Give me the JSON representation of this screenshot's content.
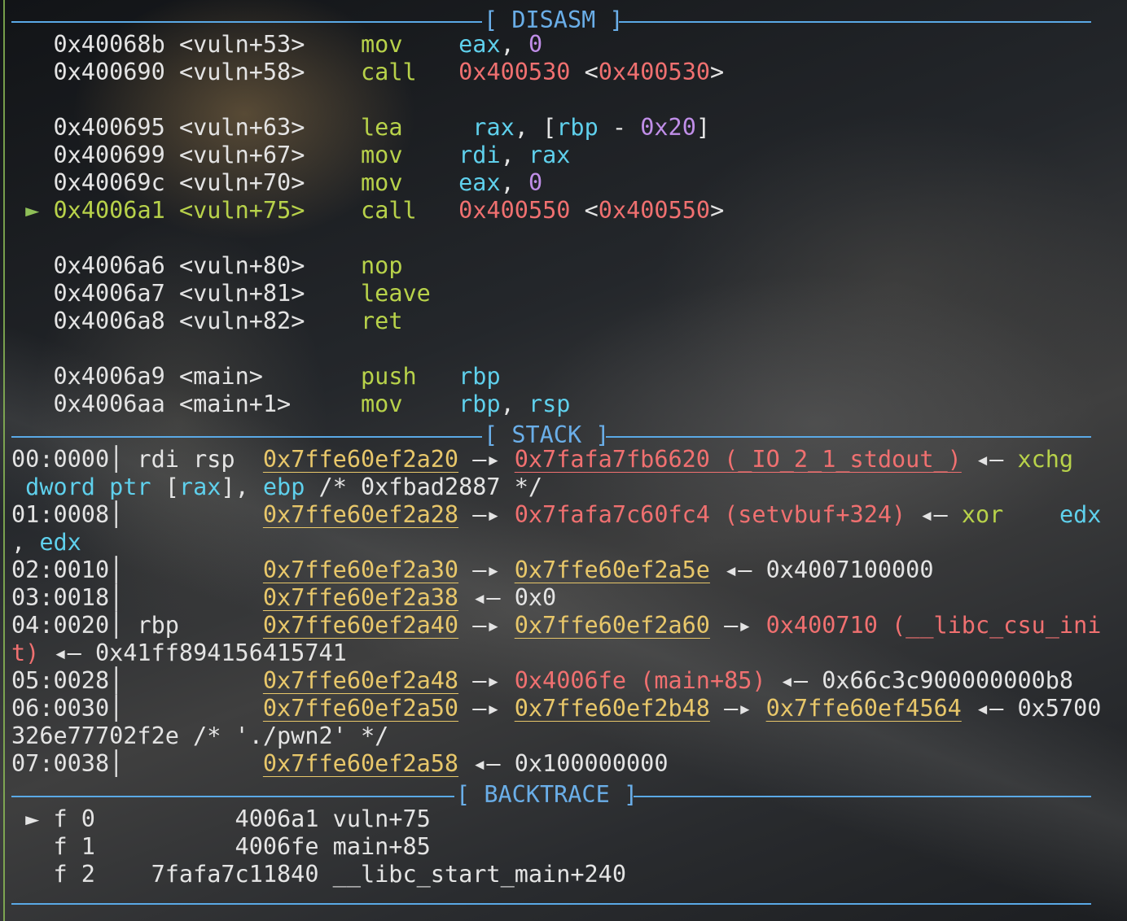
{
  "sections": {
    "disasm": "[ DISASM ]",
    "stack": "[ STACK ]",
    "backtrace": "[ BACKTRACE ]"
  },
  "disasm": [
    {
      "addr": "0x40068b",
      "sym": "<vuln+53>",
      "mn": "mov",
      "op1": "eax",
      "comma": ", ",
      "op2": "0"
    },
    {
      "addr": "0x400690",
      "sym": "<vuln+58>",
      "mn": "call",
      "t1": "0x400530",
      "lt": " <",
      "t2": "0x400530",
      "gt": ">"
    },
    {
      "addr": "0x400695",
      "sym": "<vuln+63>",
      "mn": "lea",
      "op1": "rax",
      "comma": ", [",
      "reg": "rbp",
      "minus": " - ",
      "imm": "0x20",
      "close": "]"
    },
    {
      "addr": "0x400699",
      "sym": "<vuln+67>",
      "mn": "mov",
      "op1": "rdi",
      "comma": ", ",
      "op2": "rax"
    },
    {
      "addr": "0x40069c",
      "sym": "<vuln+70>",
      "mn": "mov",
      "op1": "eax",
      "comma": ", ",
      "op2": "0"
    },
    {
      "marker": "►",
      "addr": "0x4006a1",
      "sym": "<vuln+75>",
      "mn": "call",
      "t1": "0x400550",
      "lt": " <",
      "t2": "0x400550",
      "gt": ">"
    },
    {
      "addr": "0x4006a6",
      "sym": "<vuln+80>",
      "mn": "nop"
    },
    {
      "addr": "0x4006a7",
      "sym": "<vuln+81>",
      "mn": "leave"
    },
    {
      "addr": "0x4006a8",
      "sym": "<vuln+82>",
      "mn": "ret"
    },
    {
      "addr": "0x4006a9",
      "sym": "<main>",
      "mn": "push",
      "op1": "rbp"
    },
    {
      "addr": "0x4006aa",
      "sym": "<main+1>",
      "mn": "mov",
      "op1": "rbp",
      "comma": ", ",
      "op2": "rsp"
    }
  ],
  "stack": {
    "r0": {
      "idx": "00:0000",
      "bar": "│",
      "regs": " rdi rsp  ",
      "addr": "0x7ffe60ef2a20",
      "a1": " —▸ ",
      "v1": "0x7fafa7fb6620 (_IO_2_1_stdout_)",
      "a2": " ◂— ",
      "v2": "xchg"
    },
    "r0b": {
      "t1": " dword",
      "t2": " ptr",
      "t3": " [",
      "t4": "rax",
      "t5": "], ",
      "t6": "ebp",
      "t7": " /* 0xfbad2887 */"
    },
    "r1": {
      "idx": "01:0008",
      "bar": "│",
      "pad": "          ",
      "addr": "0x7ffe60ef2a28",
      "a1": " —▸ ",
      "v1": "0x7fafa7c60fc4 (setvbuf+324)",
      "a2": " ◂— ",
      "v2": "xor",
      "gap": "    ",
      "v3": "edx"
    },
    "r1b": {
      "t1": ", ",
      "t2": "edx"
    },
    "r2": {
      "idx": "02:0010",
      "bar": "│",
      "pad": "          ",
      "addr": "0x7ffe60ef2a30",
      "a1": " —▸ ",
      "v1": "0x7ffe60ef2a5e",
      "a2": " ◂— ",
      "v2": "0x4007100000"
    },
    "r3": {
      "idx": "03:0018",
      "bar": "│",
      "pad": "          ",
      "addr": "0x7ffe60ef2a38",
      "a1": " ◂— ",
      "v1": "0x0"
    },
    "r4": {
      "idx": "04:0020",
      "bar": "│",
      "regs": " rbp      ",
      "addr": "0x7ffe60ef2a40",
      "a1": " —▸ ",
      "v1": "0x7ffe60ef2a60",
      "a2": " —▸ ",
      "v2": "0x400710 (__libc_csu_ini"
    },
    "r4b": {
      "t1": "t)",
      "t2": " ◂— 0x41ff894156415741"
    },
    "r5": {
      "idx": "05:0028",
      "bar": "│",
      "pad": "          ",
      "addr": "0x7ffe60ef2a48",
      "a1": " —▸ ",
      "v1": "0x4006fe (main+85)",
      "a2": " ◂— ",
      "v2": "0x66c3c900000000b8"
    },
    "r6": {
      "idx": "06:0030",
      "bar": "│",
      "pad": "          ",
      "addr": "0x7ffe60ef2a50",
      "a1": " —▸ ",
      "v1": "0x7ffe60ef2b48",
      "a2": " —▸ ",
      "v2": "0x7ffe60ef4564",
      "a3": " ◂— ",
      "v3": "0x5700"
    },
    "r6b": {
      "t1": "326e77702f2e /* './pwn2' */"
    },
    "r7": {
      "idx": "07:0038",
      "bar": "│",
      "pad": "          ",
      "addr": "0x7ffe60ef2a58",
      "a1": " ◂— ",
      "v1": "0x100000000"
    }
  },
  "backtrace": [
    {
      "marker": " ► ",
      "frame": "f 0",
      "pc": "          4006a1",
      "sym": " vuln+75"
    },
    {
      "marker": "   ",
      "frame": "f 1",
      "pc": "          4006fe",
      "sym": " main+85"
    },
    {
      "marker": "   ",
      "frame": "f 2",
      "pc": "    7fafa7c11840",
      "sym": " __libc_start_main+240"
    }
  ]
}
